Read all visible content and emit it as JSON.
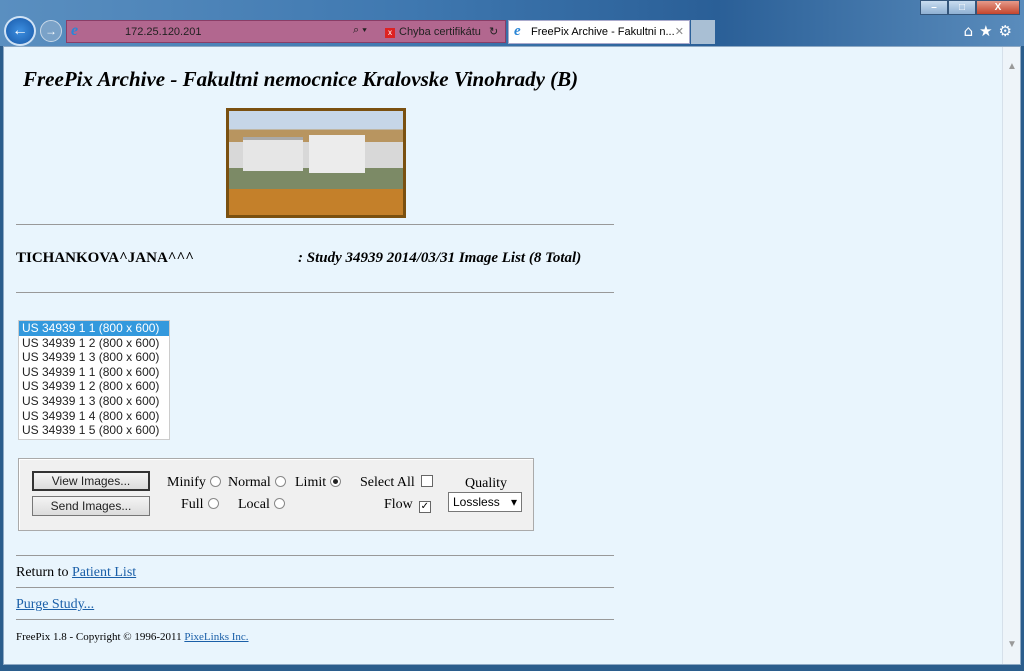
{
  "browser": {
    "url": "172.25.120.201",
    "cert_error": "Chyba certifikátu",
    "tab_title": "FreePix Archive - Fakultni n...",
    "icons": [
      "back-icon",
      "forward-icon",
      "home-icon",
      "star-icon",
      "gear-icon"
    ]
  },
  "page": {
    "title": "FreePix Archive - Fakultni nemocnice Kralovske Vinohrady (B)",
    "patient": "TICHANKOVA^JANA^^^",
    "study": ": Study 34939 2014/03/31 Image List (8 Total)",
    "images": [
      "US 34939 1 1 (800 x 600)",
      "US 34939 1 2 (800 x 600)",
      "US 34939 1 3 (800 x 600)",
      "US 34939 1 1 (800 x 600)",
      "US 34939 1 2 (800 x 600)",
      "US 34939 1 3 (800 x 600)",
      "US 34939 1 4 (800 x 600)",
      "US 34939 1 5 (800 x 600)"
    ],
    "selected_index": 0,
    "view_button": "View Images...",
    "send_button": "Send Images...",
    "options": {
      "minify": "Minify",
      "normal": "Normal",
      "limit": "Limit",
      "full": "Full",
      "local": "Local",
      "selected": "Limit",
      "select_all": "Select All",
      "select_all_checked": false,
      "flow": "Flow",
      "flow_checked": true
    },
    "quality_label": "Quality",
    "quality_value": "Lossless",
    "return_text": "Return to",
    "return_link": "Patient List",
    "purge_link": "Purge Study...",
    "footer_text": "FreePix 1.8 - Copyright © 1996-2011",
    "footer_link": "PixeLinks Inc."
  }
}
